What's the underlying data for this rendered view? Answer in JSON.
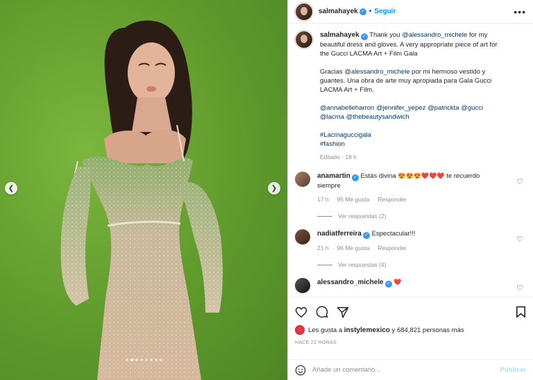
{
  "post": {
    "username": "salmahayek",
    "follow_label": "Seguir",
    "dot": "•",
    "more_label": "•••"
  },
  "caption": {
    "username": "salmahayek",
    "p1_prefix": "Thank you ",
    "p1_mention": "@alessandro_michele",
    "p1_suffix": " for my beautiful dress and gloves. A very appropriate piece of art for the Gucci LACMA Art + Film Gala",
    "p2_prefix": "Gracias ",
    "p2_mention": "@alessandro_michele",
    "p2_suffix": " por mi hermoso vestido y guantes. Una obra de arte muy apropiada para Gala Gucci LACMA Art + Film.",
    "mentions_line": "@annabelleharron @jennifer_yepez @patrickta @gucci @lacma @thebeautysandwich",
    "hashtag1": "#Lacmaguccigala",
    "hashtag2": "#fashion",
    "meta": "Editado · 18 h"
  },
  "comments": [
    {
      "username": "anamartin",
      "text": "Estás divina",
      "emojis": "😍😍😍❤️❤️❤️",
      "text2": "te recuerdo siempre",
      "time": "17 h",
      "likes": "95 Me gusta",
      "reply": "Responder",
      "replies": "Ver respuestas (2)"
    },
    {
      "username": "nadiatferreira",
      "text": "Espectacular!!!",
      "time": "21 h",
      "likes": "96 Me gusta",
      "reply": "Responder",
      "replies": "Ver respuestas (4)"
    },
    {
      "username": "alessandro_michele",
      "emojis": "❤️"
    }
  ],
  "likes": {
    "prefix": "Les gusta a ",
    "user": "instylemexico",
    "suffix": " y 684,821 personas más"
  },
  "time_ago": "HACE 22 HORAS",
  "add_comment": {
    "placeholder": "Añade un comentario...",
    "publish": "Publicar"
  },
  "icons": {
    "like": "heart-icon",
    "comment": "comment-icon",
    "share": "share-icon",
    "save": "bookmark-icon",
    "emoji": "emoji-icon",
    "prev": "chevron-left-icon",
    "next": "chevron-right-icon"
  },
  "carousel": {
    "slides": 8,
    "active": 1
  },
  "colors": {
    "link": "#0095f6",
    "mention": "#00376b",
    "verified": "#3897f0",
    "background_wall": "#6aa234"
  }
}
